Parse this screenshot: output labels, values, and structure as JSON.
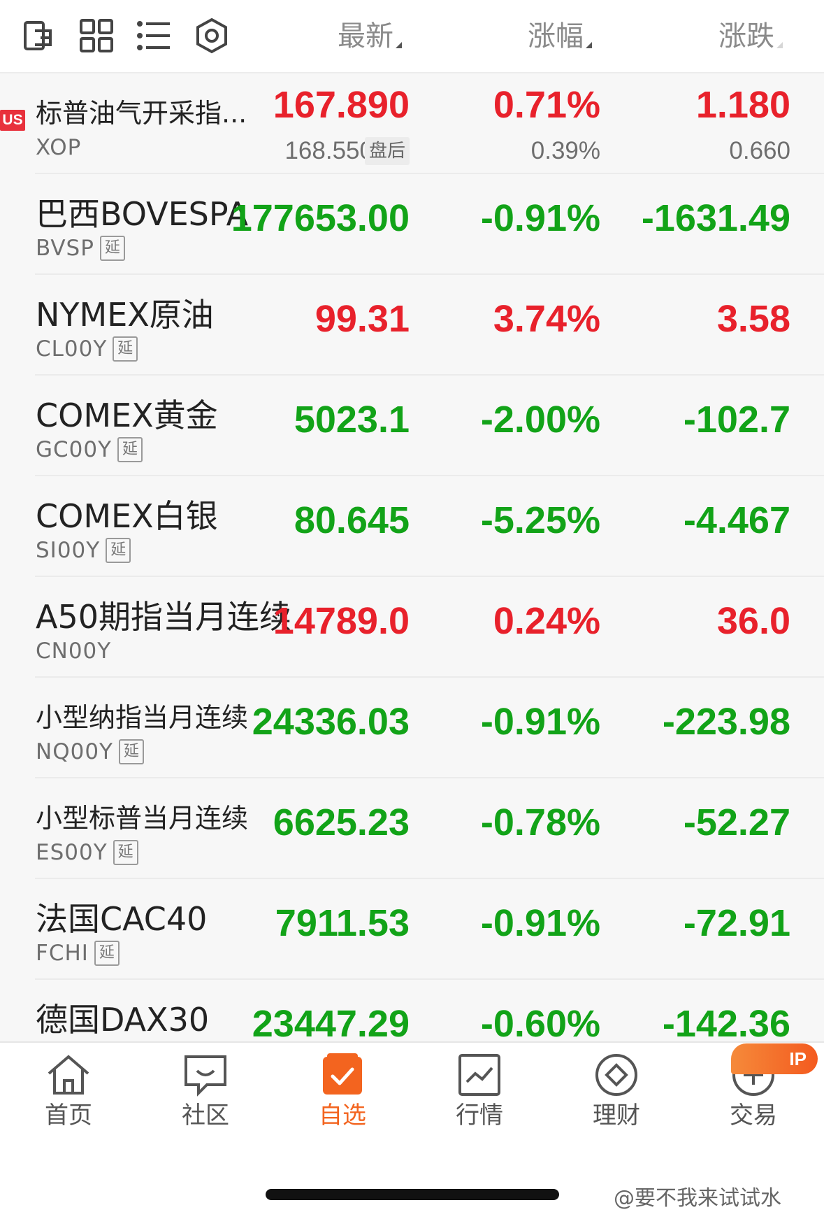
{
  "header": {
    "icons": [
      "import-icon",
      "grid-icon",
      "list-icon",
      "settings-icon"
    ],
    "columns": {
      "latest": "最新",
      "change_pct": "涨幅",
      "change": "涨跌"
    }
  },
  "colors": {
    "up": "#e8212b",
    "down": "#12a318",
    "active_tab": "#f3641f"
  },
  "rows": [
    {
      "market_badge": "US",
      "name": "标普油气开采指...",
      "code": "XOP",
      "latest": "167.890",
      "change_pct": "0.71%",
      "change": "1.180",
      "trend": "up",
      "after_hours_price": "168.550",
      "after_hours_tag": "盘后",
      "after_hours_pct": "0.39%",
      "after_hours_change": "0.660"
    },
    {
      "name": "巴西BOVESPA",
      "code": "BVSP",
      "delay": "延",
      "latest": "177653.00",
      "change_pct": "-0.91%",
      "change": "-1631.49",
      "trend": "down"
    },
    {
      "name": "NYMEX原油",
      "code": "CL00Y",
      "delay": "延",
      "latest": "99.31",
      "change_pct": "3.74%",
      "change": "3.58",
      "trend": "up"
    },
    {
      "name": "COMEX黄金",
      "code": "GC00Y",
      "delay": "延",
      "latest": "5023.1",
      "change_pct": "-2.00%",
      "change": "-102.7",
      "trend": "down"
    },
    {
      "name": "COMEX白银",
      "code": "SI00Y",
      "delay": "延",
      "latest": "80.645",
      "change_pct": "-5.25%",
      "change": "-4.467",
      "trend": "down"
    },
    {
      "name": "A50期指当月连续",
      "code": "CN00Y",
      "latest": "14789.0",
      "change_pct": "0.24%",
      "change": "36.0",
      "trend": "up"
    },
    {
      "name": "小型纳指当月连续",
      "code": "NQ00Y",
      "delay": "延",
      "latest": "24336.03",
      "change_pct": "-0.91%",
      "change": "-223.98",
      "trend": "down"
    },
    {
      "name": "小型标普当月连续",
      "code": "ES00Y",
      "delay": "延",
      "latest": "6625.23",
      "change_pct": "-0.78%",
      "change": "-52.27",
      "trend": "down"
    },
    {
      "name": "法国CAC40",
      "code": "FCHI",
      "delay": "延",
      "latest": "7911.53",
      "change_pct": "-0.91%",
      "change": "-72.91",
      "trend": "down"
    },
    {
      "name": "德国DAX30",
      "code": "",
      "latest": "23447.29",
      "change_pct": "-0.60%",
      "change": "-142.36",
      "trend": "down"
    }
  ],
  "nav": {
    "items": [
      {
        "label": "首页",
        "icon": "home-icon"
      },
      {
        "label": "社区",
        "icon": "community-icon"
      },
      {
        "label": "自选",
        "icon": "watchlist-icon",
        "active": true
      },
      {
        "label": "行情",
        "icon": "market-chart-icon"
      },
      {
        "label": "理财",
        "icon": "wealth-icon"
      },
      {
        "label": "交易",
        "icon": "trade-plus-icon"
      }
    ],
    "promo_badge": "IP"
  },
  "watermark": "@要不我来试试水"
}
